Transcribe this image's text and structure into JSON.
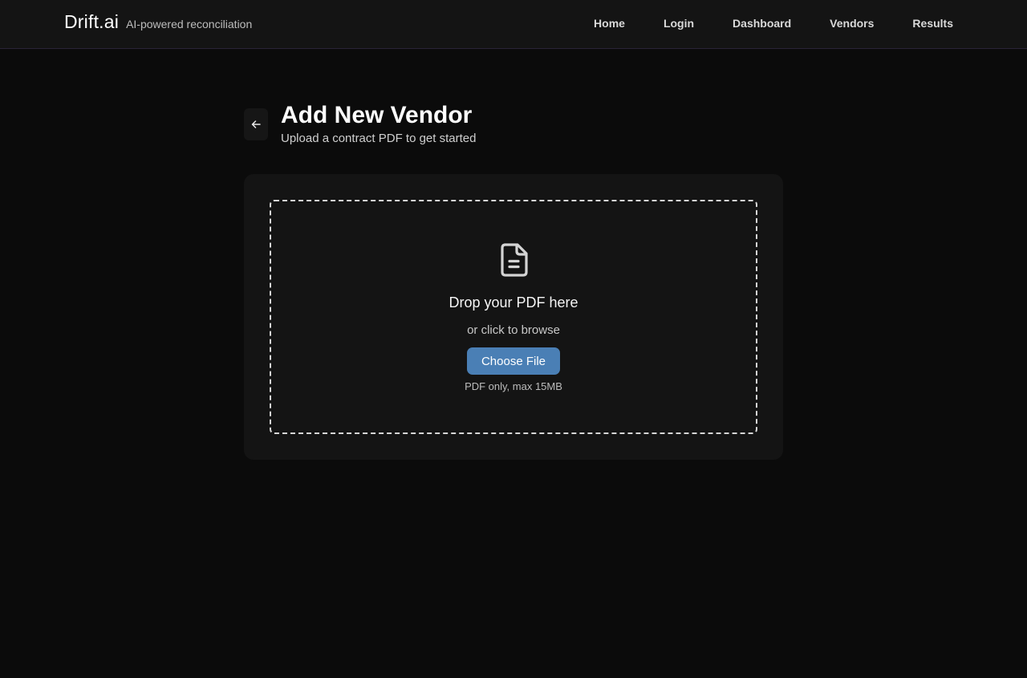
{
  "header": {
    "brand_name": "Drift.ai",
    "brand_tagline": "AI-powered reconciliation",
    "nav": [
      {
        "label": "Home"
      },
      {
        "label": "Login"
      },
      {
        "label": "Dashboard"
      },
      {
        "label": "Vendors"
      },
      {
        "label": "Results"
      }
    ]
  },
  "page": {
    "back_icon": "arrow-left-icon",
    "title": "Add New Vendor",
    "subtitle": "Upload a contract PDF to get started"
  },
  "upload": {
    "icon": "document-icon",
    "title": "Drop your PDF here",
    "subtitle": "or click to browse",
    "button_label": "Choose File",
    "hint": "PDF only, max 15MB"
  },
  "colors": {
    "background": "#0b0b0b",
    "surface": "#141414",
    "accent": "#4a7fb5",
    "text": "#f2f2f2"
  }
}
